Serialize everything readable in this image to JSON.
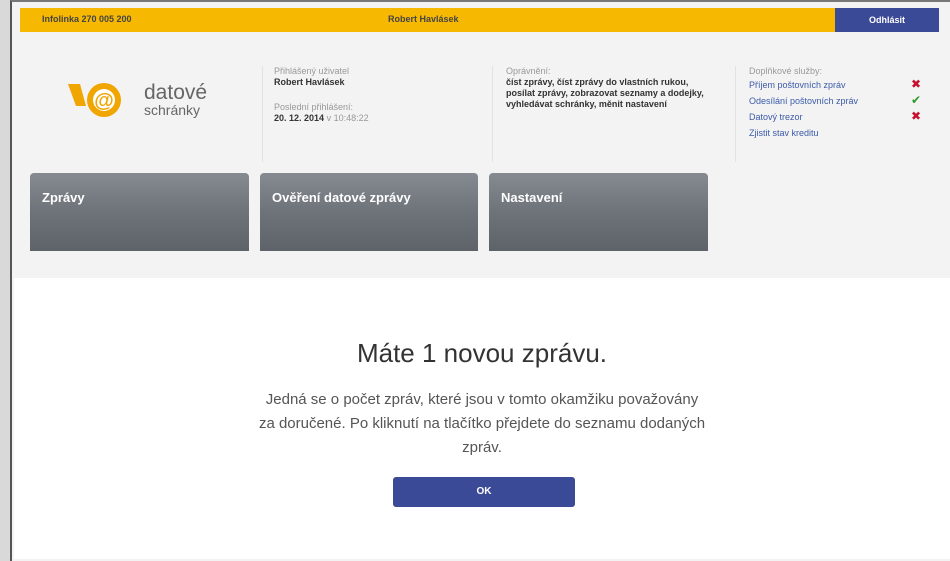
{
  "topbar": {
    "infolink": "Infolinka 270 005 200",
    "username": "Robert Havlásek",
    "logout_label": "Odhlásit"
  },
  "logo": {
    "brand_line1": "datové",
    "brand_line2": "schránky",
    "colors": {
      "orange": "#f0a500",
      "gray": "#777777"
    }
  },
  "user": {
    "label": "Přihlášený uživatel",
    "name": "Robert Havlásek",
    "last_login_label": "Poslední přihlášení:",
    "last_login_date": "20. 12. 2014",
    "last_login_time_sep": "v",
    "last_login_time": "10:48:22"
  },
  "permissions": {
    "label": "Oprávnění:",
    "text": "číst zprávy, číst zprávy do vlastních rukou, posílat zprávy, zobrazovat seznamy a dodejky, vyhledávat schránky, měnit nastavení"
  },
  "services": {
    "label": "Doplňkové služby:",
    "items": [
      {
        "label": "Příjem poštovních zpráv",
        "status": "x"
      },
      {
        "label": "Odesílání poštovních zpráv",
        "status": "ok"
      },
      {
        "label": "Datový trezor",
        "status": "x"
      },
      {
        "label": "Zjistit stav kreditu",
        "status": ""
      }
    ]
  },
  "tabs": [
    {
      "label": "Zprávy"
    },
    {
      "label": "Ověření datové zprávy"
    },
    {
      "label": "Nastavení"
    }
  ],
  "message": {
    "headline": "Máte 1 novou zprávu.",
    "description": "Jedná se o počet zpráv, které jsou v tomto okamžiku považovány za doručené. Po kliknutí na tlačítko přejdete do seznamu dodaných zpráv.",
    "ok_label": "OK"
  },
  "colors": {
    "topbar": "#f6b800",
    "button": "#3b4a96",
    "tab": "#6e737a",
    "error": "#c8102e",
    "success": "#2a9a2a"
  }
}
